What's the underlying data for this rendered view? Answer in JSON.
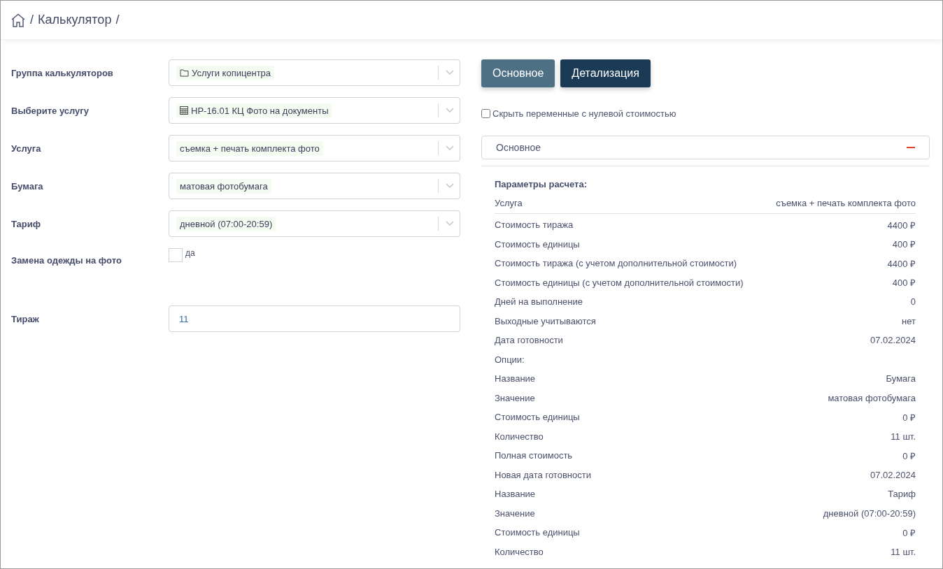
{
  "breadcrumb": [
    "/",
    "Калькулятор",
    "/"
  ],
  "fields": [
    {
      "kind": "group-select",
      "label": "Группа калькуляторов",
      "value": "Услуги копицентра"
    },
    {
      "kind": "service-select",
      "label": "Выберите услугу",
      "value": "НР-16.01 КЦ Фото на документы"
    },
    {
      "kind": "select",
      "label": "Услуга",
      "value": "съемка + печать комплекта фото"
    },
    {
      "kind": "select",
      "label": "Бумага",
      "value": "матовая фотобумага"
    },
    {
      "kind": "select",
      "label": "Тариф",
      "value": "дневной (07:00-20:59)"
    },
    {
      "kind": "checkbox",
      "label": "Замена одежды на фото",
      "value": "да",
      "checked": false
    },
    {
      "kind": "input",
      "label": "Тираж",
      "value": "11"
    }
  ],
  "tabs": [
    {
      "label": "Основное",
      "selected": false
    },
    {
      "label": "Детализация",
      "selected": true
    }
  ],
  "hide_zero": {
    "label": "Скрыть переменные с нулевой стоимостью",
    "checked": false
  },
  "section": {
    "title": "Основное",
    "expanded": true
  },
  "details": [
    {
      "kind": "heading",
      "label": "Параметры расчета:"
    },
    {
      "kind": "row-divided",
      "label": "Услуга",
      "value": "съемка + печать комплекта фото"
    },
    {
      "kind": "row",
      "label": "Стоимость тиража",
      "value": "4400 ₽"
    },
    {
      "kind": "row",
      "label": "Стоимость единицы",
      "value": "400 ₽"
    },
    {
      "kind": "row",
      "label": "Стоимость тиража (с учетом дополнительной стоимости)",
      "value": "4400 ₽"
    },
    {
      "kind": "row",
      "label": "Стоимость единицы (с учетом дополнительной стоимости)",
      "value": "400 ₽"
    },
    {
      "kind": "row",
      "label": "Дней на выполнение",
      "value": "0"
    },
    {
      "kind": "row",
      "label": "Выходные учитываются",
      "value": "нет"
    },
    {
      "kind": "row",
      "label": "Дата готовности",
      "value": "07.02.2024"
    },
    {
      "kind": "label",
      "label": "Опции:"
    },
    {
      "kind": "row",
      "label": "Название",
      "value": "Бумага"
    },
    {
      "kind": "row",
      "label": "Значение",
      "value": "матовая фотобумага"
    },
    {
      "kind": "row",
      "label": "Стоимость единицы",
      "value": "0 ₽"
    },
    {
      "kind": "row",
      "label": "Количество",
      "value": "11 шт."
    },
    {
      "kind": "row",
      "label": "Полная стоимость",
      "value": "0 ₽"
    },
    {
      "kind": "row",
      "label": "Новая дата готовности",
      "value": "07.02.2024"
    },
    {
      "kind": "row",
      "label": "Название",
      "value": "Тариф"
    },
    {
      "kind": "row",
      "label": "Значение",
      "value": "дневной (07:00-20:59)"
    },
    {
      "kind": "row",
      "label": "Стоимость единицы",
      "value": "0 ₽"
    },
    {
      "kind": "row",
      "label": "Количество",
      "value": "11 шт."
    }
  ]
}
